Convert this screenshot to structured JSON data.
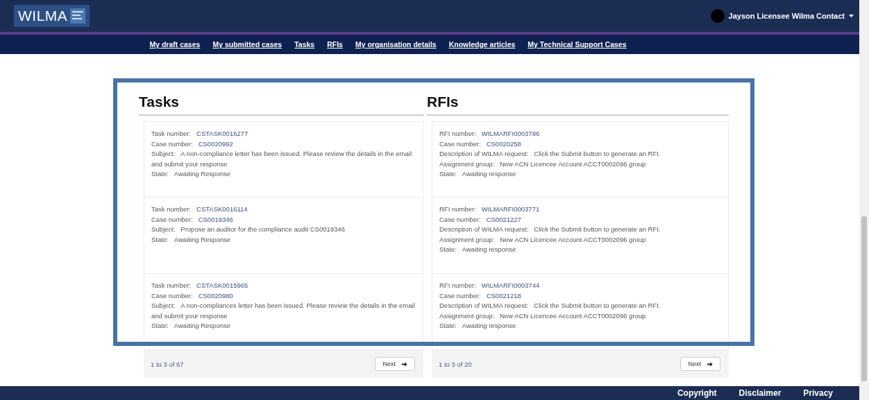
{
  "header": {
    "logo": "WILMA",
    "user": "Jayson Licensee Wilma Contact"
  },
  "nav": [
    "My draft cases",
    "My submitted cases",
    "Tasks",
    "RFIs",
    "My organisation details",
    "Knowledge articles",
    "My Technical Support Cases"
  ],
  "panels": [
    {
      "title": "Tasks",
      "cards": [
        {
          "fields": [
            {
              "label": "Task number:",
              "value": "CSTASK0016277",
              "kind": "link"
            },
            {
              "label": "Case number:",
              "value": "CS0020992",
              "kind": "link"
            },
            {
              "label": "Subject:",
              "value": "A non-compliance letter has been issued. Please review the details in the email and submit your response",
              "kind": "text"
            },
            {
              "label": "State:",
              "value": "Awaiting Response",
              "kind": "text"
            }
          ]
        },
        {
          "fields": [
            {
              "label": "Task number:",
              "value": "CSTASK0016114",
              "kind": "link"
            },
            {
              "label": "Case number:",
              "value": "CS0019346",
              "kind": "link"
            },
            {
              "label": "Subject:",
              "value": "Propose an auditor for the compliance audit CS0019346",
              "kind": "text"
            },
            {
              "label": "State:",
              "value": "Awaiting Response",
              "kind": "text"
            }
          ]
        },
        {
          "fields": [
            {
              "label": "Task number:",
              "value": "CSTASK0015965",
              "kind": "link"
            },
            {
              "label": "Case number:",
              "value": "CS0020980",
              "kind": "link"
            },
            {
              "label": "Subject:",
              "value": "A non-compliances letter has been issued. Please review the details in the email and submit your response",
              "kind": "text"
            },
            {
              "label": "State:",
              "value": "Awaiting Response",
              "kind": "text"
            }
          ]
        }
      ],
      "count": "1 to 3 of 67",
      "next": "Next"
    },
    {
      "title": "RFIs",
      "cards": [
        {
          "fields": [
            {
              "label": "RFI number:",
              "value": "WILMARFI0003786",
              "kind": "link"
            },
            {
              "label": "Case number:",
              "value": "CS0020258",
              "kind": "link"
            },
            {
              "label": "Description of WILMA request:",
              "value": "Click the Submit button to generate an RFI.",
              "kind": "text"
            },
            {
              "label": "Assignment group:",
              "value": "New ACN Licencee Account ACCT0002096 group",
              "kind": "text"
            },
            {
              "label": "State:",
              "value": "Awaiting response",
              "kind": "text"
            }
          ]
        },
        {
          "fields": [
            {
              "label": "RFI number:",
              "value": "WILMARFI0003771",
              "kind": "link"
            },
            {
              "label": "Case number:",
              "value": "CS0021227",
              "kind": "link"
            },
            {
              "label": "Description of WILMA request:",
              "value": "Click the Submit button to generate an RFI.",
              "kind": "text"
            },
            {
              "label": "Assignment group:",
              "value": "New ACN Licencee Account ACCT0002096 group",
              "kind": "text"
            },
            {
              "label": "State:",
              "value": "Awaiting response",
              "kind": "text"
            }
          ]
        },
        {
          "fields": [
            {
              "label": "RFI number:",
              "value": "WILMARFI0003744",
              "kind": "link"
            },
            {
              "label": "Case number:",
              "value": "CS0021218",
              "kind": "link"
            },
            {
              "label": "Description of WILMA request:",
              "value": "Click the Submit button to generate an RFI.",
              "kind": "text"
            },
            {
              "label": "Assignment group:",
              "value": "New ACN Licencee Account ACCT0002096 group",
              "kind": "text"
            },
            {
              "label": "State:",
              "value": "Awaiting response",
              "kind": "text"
            }
          ]
        }
      ],
      "count": "1 to 3 of 20",
      "next": "Next"
    }
  ],
  "footer": [
    "Copyright",
    "Disclaimer",
    "Privacy"
  ]
}
